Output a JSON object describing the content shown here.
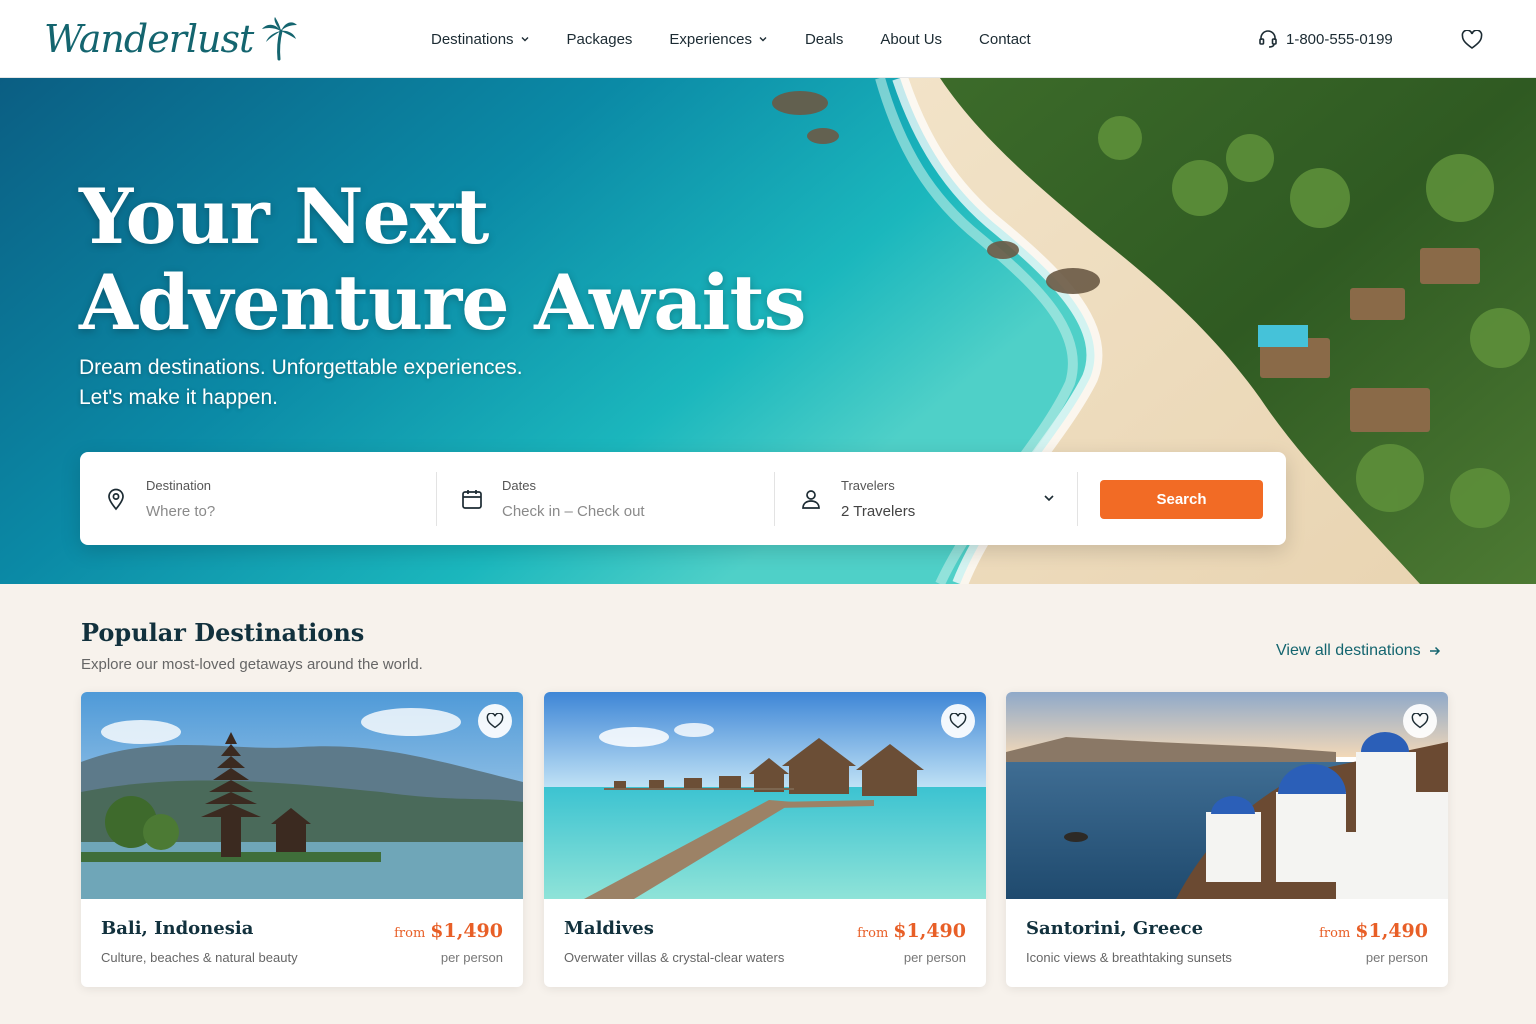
{
  "brand": {
    "name": "Wanderlust",
    "color": "#14656f",
    "icon": "palm-tree-icon"
  },
  "nav": {
    "items": [
      {
        "label": "Destinations",
        "dropdown": true
      },
      {
        "label": "Packages",
        "dropdown": false
      },
      {
        "label": "Experiences",
        "dropdown": true
      },
      {
        "label": "Deals",
        "dropdown": false
      },
      {
        "label": "About Us",
        "dropdown": false
      },
      {
        "label": "Contact",
        "dropdown": false
      }
    ]
  },
  "header": {
    "phone": "1-800-555-0199",
    "phone_icon": "headset-icon",
    "wishlist_icon": "heart-icon"
  },
  "hero": {
    "title_line1": "Your Next",
    "title_line2": "Adventure Awaits",
    "subtitle_line1": "Dream destinations. Unforgettable experiences.",
    "subtitle_line2": "Let's make it happen."
  },
  "search": {
    "destination": {
      "label": "Destination",
      "placeholder": "Where to?",
      "icon": "location-pin-icon"
    },
    "dates": {
      "label": "Dates",
      "placeholder": "Check in – Check out",
      "icon": "calendar-icon"
    },
    "travelers": {
      "label": "Travelers",
      "value": "2 Travelers",
      "icon": "user-icon"
    },
    "button": "Search",
    "accent": "#f26b25"
  },
  "section": {
    "title": "Popular Destinations",
    "subtitle": "Explore our most-loved getaways around the world.",
    "view_all": "View all destinations"
  },
  "cards": [
    {
      "name": "Bali, Indonesia",
      "desc": "Culture, beaches & natural beauty",
      "from": "from",
      "price": "$1,490",
      "per": "per person"
    },
    {
      "name": "Maldives",
      "desc": "Overwater villas & crystal-clear waters",
      "from": "from",
      "price": "$1,490",
      "per": "per person"
    },
    {
      "name": "Santorini, Greece",
      "desc": "Iconic views & breathtaking sunsets",
      "from": "from",
      "price": "$1,490",
      "per": "per person"
    }
  ]
}
